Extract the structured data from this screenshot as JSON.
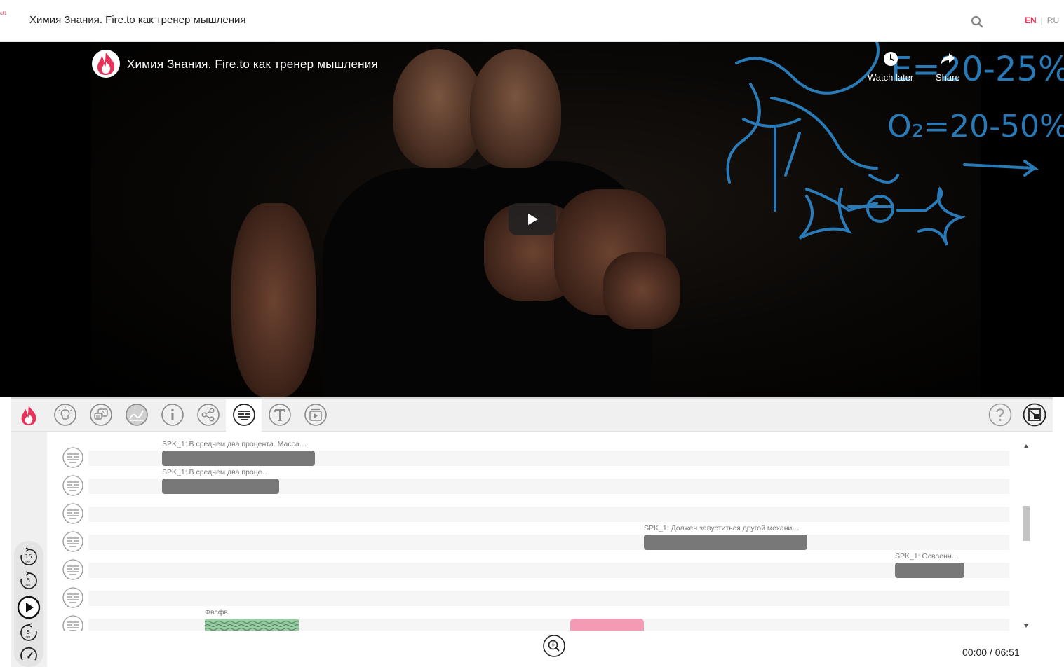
{
  "header": {
    "logo_text": "uf1",
    "title": "Химия Знания. Fire.to как тренер мышления",
    "search_icon": "search-icon",
    "lang": {
      "en": "EN",
      "separator": "|",
      "ru": "RU"
    }
  },
  "video": {
    "title": "Химия Знания. Fire.to как тренер мышления",
    "watch_later": "Watch later",
    "share": "Share",
    "play_icon": "play-icon",
    "board_formula_1": "E=20-25%",
    "board_formula_2": "O₂=20-50%"
  },
  "toolbar": {
    "tools": [
      {
        "name": "ideas",
        "icon": "lightbulb-icon"
      },
      {
        "name": "questions",
        "icon": "question-bubble-icon"
      },
      {
        "name": "graph",
        "icon": "chart-icon"
      },
      {
        "name": "info",
        "icon": "info-icon"
      },
      {
        "name": "share",
        "icon": "share-icon"
      },
      {
        "name": "transcript",
        "icon": "lines-icon",
        "active": true
      },
      {
        "name": "text",
        "icon": "text-icon"
      },
      {
        "name": "video-library",
        "icon": "video-icon"
      }
    ],
    "help_icon": "help-icon",
    "fullscreen_icon": "exit-fullscreen-icon"
  },
  "rail": {
    "back15": "15",
    "back5": "5",
    "fwd5": "5",
    "unit": "сек"
  },
  "timeline": {
    "rows": [
      {
        "label": "SPK_1: В среднем два процента. Масса…"
      },
      {
        "label": "SPK_1: В среднем два проце…"
      },
      {
        "label": ""
      },
      {
        "label": "SPK_1: Должен запуститься другой механи…"
      },
      {
        "label": "SPK_1: Освоенн…"
      },
      {
        "label": ""
      },
      {
        "label": "Фвсфв"
      }
    ],
    "colors": {
      "segment": "#787878",
      "wave": "#7fbf8f",
      "pink": "#f49ab5"
    }
  },
  "player": {
    "time": "00:00 / 06:51"
  }
}
